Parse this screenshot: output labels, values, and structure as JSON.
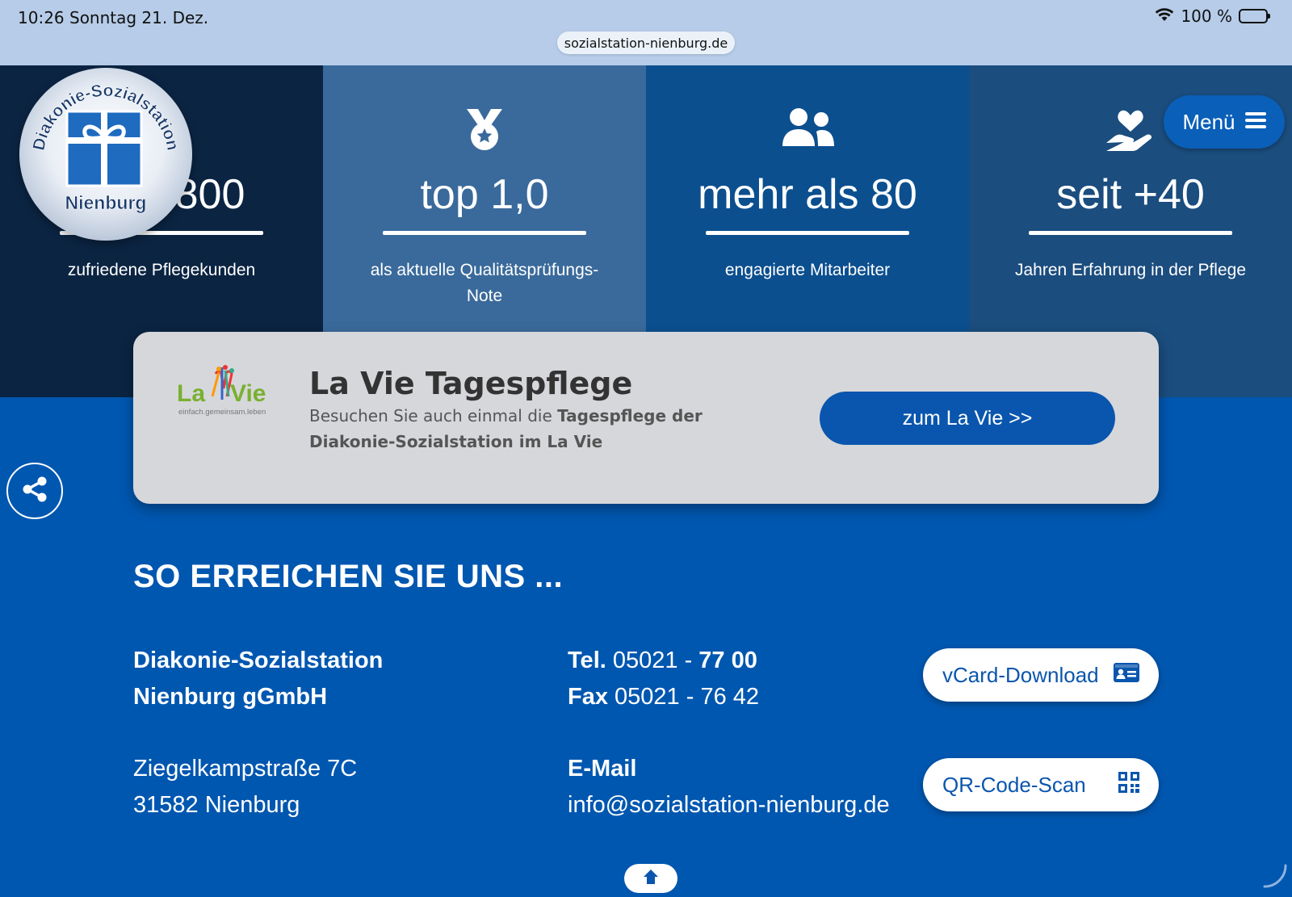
{
  "statusbar": {
    "time": "10:26",
    "date": "Sonntag 21. Dez.",
    "battery": "100 %",
    "url": "sozialstation-nienburg.de"
  },
  "logo": {
    "arc_text": "Diakonie-Sozialstation",
    "bottom_text": "Nienburg"
  },
  "menu": {
    "label": "Menü"
  },
  "stats": [
    {
      "value": "800",
      "desc": "zufriedene Pflegekunden",
      "bg": "#0b2442",
      "icon": "none"
    },
    {
      "value": "top 1,0",
      "desc": "als aktuelle Qualitätsprüfungs-Note",
      "bg": "#3a6a9b",
      "icon": "medal-icon"
    },
    {
      "value": "mehr als 80",
      "desc": "engagierte Mitarbeiter",
      "bg": "#0b4f8f",
      "icon": "users-icon"
    },
    {
      "value": "seit +40",
      "desc": "Jahren Erfahrung in der Pflege",
      "bg": "#1b4d7e",
      "icon": "hand-heart-icon"
    }
  ],
  "lavie": {
    "logo_text_la": "La",
    "logo_text_vie": "Vie",
    "logo_tagline": "einfach.gemeinsam.leben",
    "title": "La Vie Tagespflege",
    "text_plain": "Besuchen Sie auch einmal die ",
    "text_bold": "Tagespflege der Diakonie-Sozialstation im La Vie",
    "button": "zum La Vie >>"
  },
  "contact": {
    "title": "SO ERREICHEN SIE UNS ...",
    "org_line1": "Diakonie-Sozialstation",
    "org_line2": "Nienburg gGmbH",
    "street": "Ziegelkampstraße 7C",
    "city": "31582 Nienburg",
    "tel_label": "Tel.",
    "tel_prefix": "05021 - ",
    "tel_number": "77 00",
    "fax_label": "Fax",
    "fax_number": "05021 - 76 42",
    "email_label": "E-Mail",
    "email": "info@sozialstation-nienburg.de",
    "vcard_button": "vCard-Download",
    "qr_button": "QR-Code-Scan"
  },
  "colors": {
    "page_bg": "#0057b0",
    "accent": "#0a56ae"
  }
}
